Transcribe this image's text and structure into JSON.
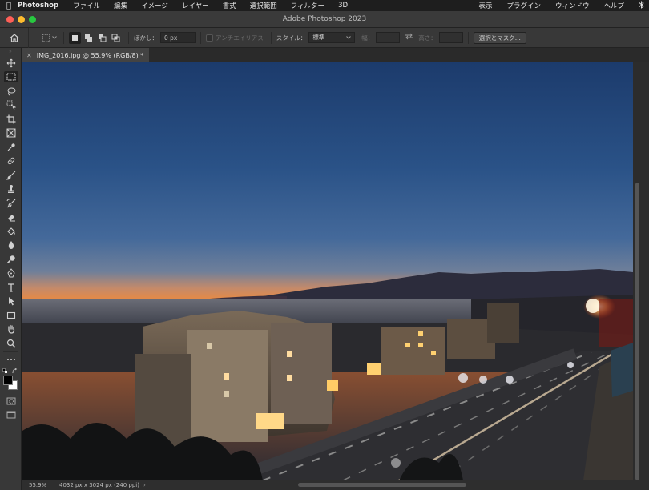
{
  "menubar": {
    "app": "Photoshop",
    "items": [
      "ファイル",
      "編集",
      "イメージ",
      "レイヤー",
      "書式",
      "選択範囲",
      "フィルター",
      "3D"
    ],
    "right": [
      "表示",
      "プラグイン",
      "ウィンドウ",
      "ヘルプ"
    ]
  },
  "window": {
    "title": "Adobe Photoshop 2023"
  },
  "options": {
    "feather_label": "ぼかし：",
    "feather_value": "0 px",
    "antialias_label": "アンチエイリアス",
    "style_label": "スタイル：",
    "style_value": "標準",
    "width_label": "幅：",
    "height_label": "高さ：",
    "select_mask_button": "選択とマスク..."
  },
  "document": {
    "tab_title": "IMG_2016.jpg @ 55.9% (RGB/8) *"
  },
  "status": {
    "zoom": "55.9%",
    "dimensions": "4032 px x 3024 px (240 ppi)"
  },
  "colors": {
    "accent_foreground": "#000000",
    "accent_background": "#ffffff"
  }
}
